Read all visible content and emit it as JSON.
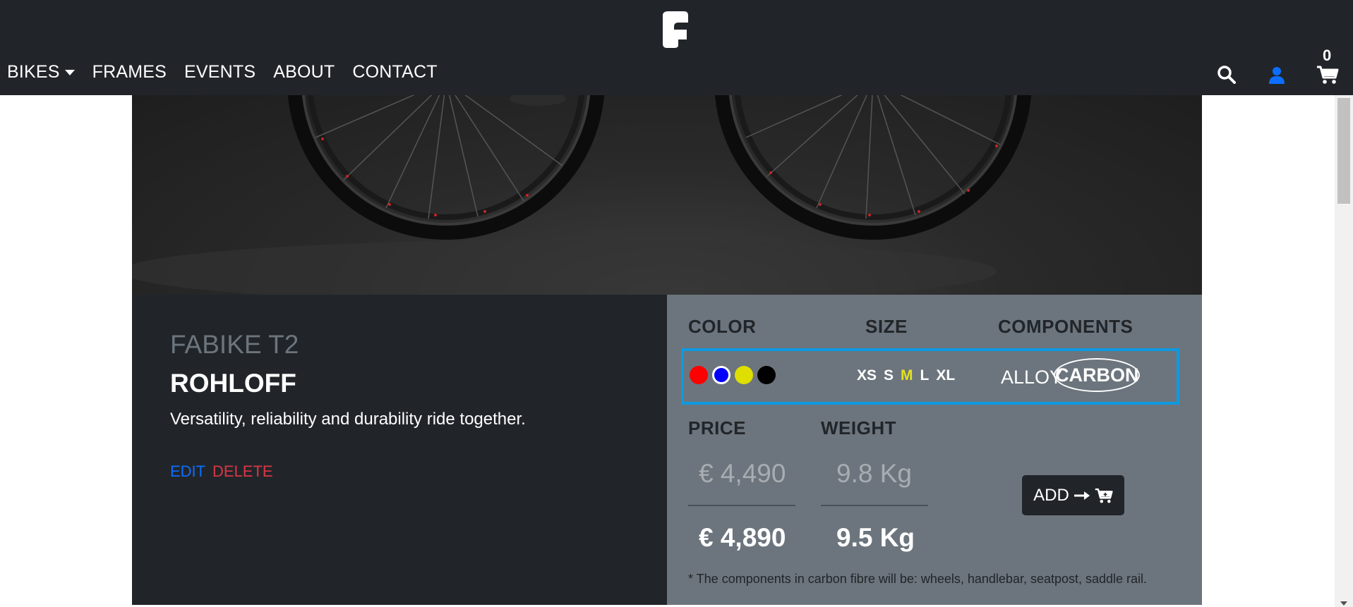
{
  "nav": {
    "links": [
      "BIKES",
      "FRAMES",
      "EVENTS",
      "ABOUT",
      "CONTACT"
    ],
    "cart_count": "0",
    "icons": [
      "logo-icon",
      "search-icon",
      "user-icon",
      "cart-icon"
    ],
    "user_icon_color": "#0d6efd"
  },
  "product": {
    "brand": "FABIKE T2",
    "model": "ROHLOFF",
    "tagline": "Versatility, reliability and durability ride together.",
    "edit_label": "EDIT",
    "delete_label": "DELETE"
  },
  "options": {
    "color_header": "COLOR",
    "size_header": "SIZE",
    "components_header": "COMPONENTS",
    "colors": [
      "#ff0000",
      "#0000ff",
      "#dede00",
      "#000000"
    ],
    "selected_color": "#0000ff",
    "sizes": [
      "XS",
      "S",
      "M",
      "L",
      "XL"
    ],
    "selected_size": "M",
    "components": [
      "ALLOY",
      "CARBON"
    ],
    "selected_component": "CARBON"
  },
  "pricing": {
    "price_header": "PRICE",
    "weight_header": "WEIGHT",
    "old_price": "€ 4,490",
    "old_weight": "9.8 Kg",
    "new_price": "€ 4,890",
    "new_weight": "9.5 Kg",
    "add_label": "ADD",
    "note": "* The components in carbon fibre will be: wheels, handlebar, seatpost, saddle rail."
  },
  "colors": {
    "navbar": "#212529",
    "right_panel": "#6c757d",
    "highlight_border": "#0d9ae0",
    "selected_size": "#e2e21d",
    "edit": "#0d6efd",
    "delete": "#dc3545"
  }
}
